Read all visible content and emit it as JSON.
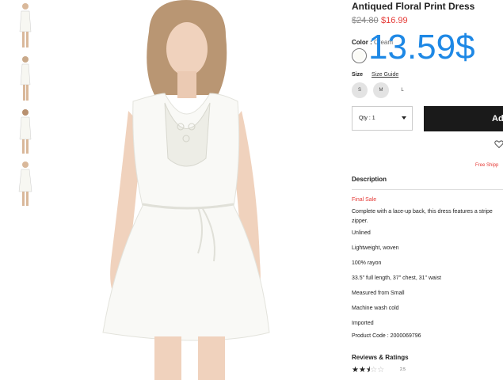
{
  "product": {
    "title": "Antiqued Floral Print Dress",
    "price_old": "$24.80",
    "price_new": "$16.99",
    "overlay_price": "13.59$"
  },
  "color": {
    "label": "Color :",
    "value": "Cream"
  },
  "size": {
    "label": "Size",
    "guide": "Size Guide",
    "options": [
      "S",
      "M",
      "L"
    ]
  },
  "purchase": {
    "qty": "Qty : 1",
    "add_label": "Add",
    "free_shipping": "Free Shipp"
  },
  "description": {
    "title": "Description",
    "final_sale": "Final Sale",
    "text_line1": "Complete with a lace-up back, this dress features a stripe",
    "text_line2": "zipper.",
    "details": [
      "Unlined",
      "Lightweight, woven",
      "100% rayon",
      "33.5\" full length, 37\" chest, 31\" waist",
      "Measured from Small",
      "Machine wash cold",
      "Imported",
      "Product Code : 2000069796"
    ]
  },
  "reviews": {
    "title": "Reviews & Ratings",
    "rating": "2.5"
  },
  "colors": {
    "sale_red": "#e53935",
    "overlay_blue": "#1e88e5",
    "button_black": "#1a1a1a"
  }
}
